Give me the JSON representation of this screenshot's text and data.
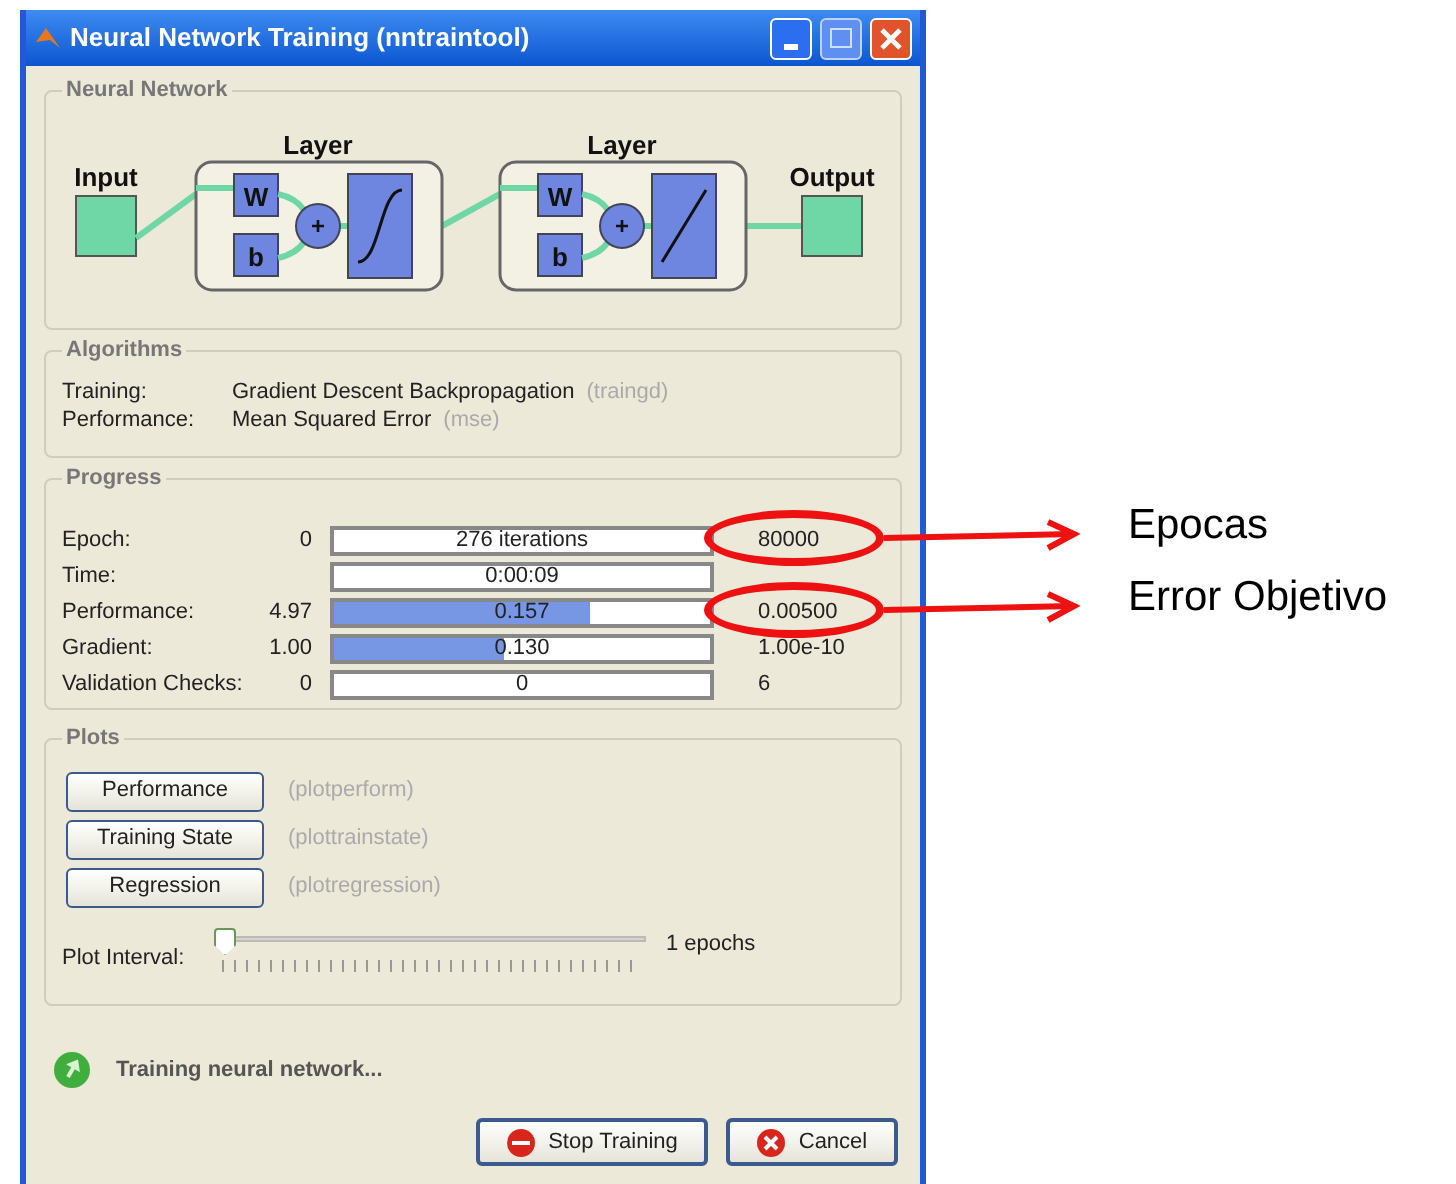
{
  "window": {
    "title": "Neural Network Training (nntraintool)"
  },
  "network": {
    "title": "Neural Network",
    "input_label": "Input",
    "output_label": "Output",
    "layers": [
      {
        "title": "Layer",
        "weight": "W",
        "bias": "b",
        "sum": "+",
        "kind": "sigmoid"
      },
      {
        "title": "Layer",
        "weight": "W",
        "bias": "b",
        "sum": "+",
        "kind": "linear"
      }
    ]
  },
  "algorithms": {
    "title": "Algorithms",
    "rows": [
      {
        "label": "Training:",
        "value": "Gradient Descent Backpropagation",
        "code": "(traingd)"
      },
      {
        "label": "Performance:",
        "value": "Mean Squared Error",
        "code": "(mse)"
      }
    ]
  },
  "progress": {
    "title": "Progress",
    "rows": [
      {
        "label": "Epoch:",
        "start": "0",
        "bar_text": "276 iterations",
        "end": "80000",
        "annotation": "Epocas"
      },
      {
        "label": "Time:",
        "bar_text": "0:00:09"
      },
      {
        "label": "Performance:",
        "start": "4.97",
        "bar_text": "0.157",
        "level": 0.68,
        "end": "0.00500",
        "annotation": "Error Objetivo"
      },
      {
        "label": "Gradient:",
        "start": "1.00",
        "bar_text": "0.130",
        "level": 0.45,
        "end": "1.00e-10"
      },
      {
        "label": "Validation Checks:",
        "start": "0",
        "bar_text": "0",
        "end": "6"
      }
    ]
  },
  "plots": {
    "title": "Plots",
    "buttons": [
      {
        "label": "Performance",
        "function": "(plotperform)"
      },
      {
        "label": "Training State",
        "function": "(plottrainstate)"
      },
      {
        "label": "Regression",
        "function": "(plotregression)"
      }
    ],
    "interval": {
      "label": "Plot Interval:",
      "level": 0,
      "reading": "1 epochs"
    }
  },
  "status": "Training neural network...",
  "buttons": [
    {
      "label": "Stop Training",
      "kind": "stop"
    },
    {
      "label": "Cancel",
      "kind": "cancel"
    }
  ]
}
